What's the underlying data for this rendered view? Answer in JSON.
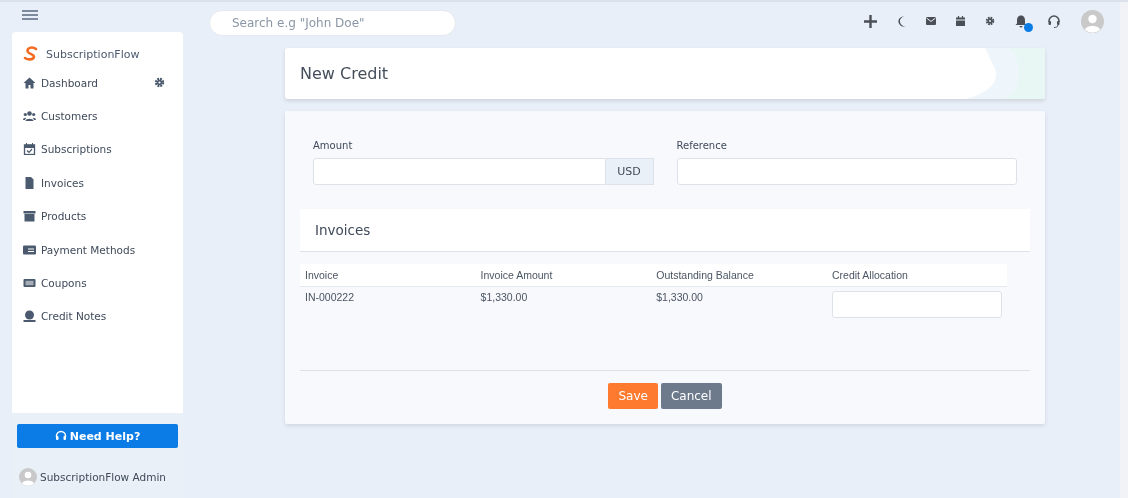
{
  "topbar": {
    "search_placeholder": "Search e.g \"John Doe\"",
    "notification": true
  },
  "sidebar": {
    "brand": "SubscriptionFlow",
    "items": [
      {
        "label": "Dashboard",
        "has_settings": true
      },
      {
        "label": "Customers",
        "has_settings": false
      },
      {
        "label": "Subscriptions",
        "has_settings": false
      },
      {
        "label": "Invoices",
        "has_settings": false
      },
      {
        "label": "Products",
        "has_settings": false
      },
      {
        "label": "Payment Methods",
        "has_settings": false
      },
      {
        "label": "Coupons",
        "has_settings": false
      },
      {
        "label": "Credit Notes",
        "has_settings": false
      }
    ],
    "help_button": "Need Help?",
    "user": "SubscriptionFlow Admin"
  },
  "page_title": "New Credit",
  "form": {
    "amount_label": "Amount",
    "currency": "USD",
    "reference_label": "Reference"
  },
  "invoices": {
    "title": "Invoices",
    "columns": [
      "Invoice",
      "Invoice Amount",
      "Outstanding Balance",
      "Credit Allocation"
    ],
    "rows": [
      {
        "invoice": "IN-000222",
        "amount": "$1,330.00",
        "balance": "$1,330.00"
      }
    ]
  },
  "buttons": {
    "save": "Save",
    "cancel": "Cancel"
  }
}
